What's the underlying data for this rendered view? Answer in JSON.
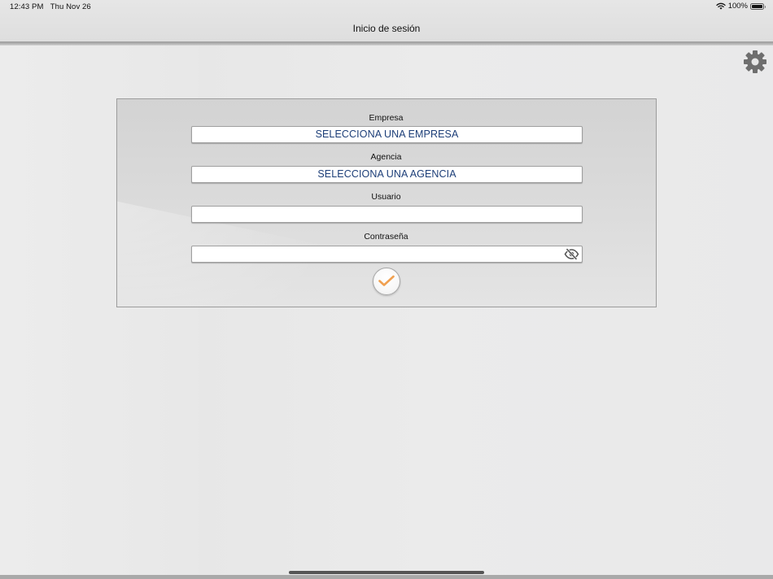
{
  "status_bar": {
    "time": "12:43 PM",
    "date": "Thu Nov 26",
    "battery_percent": "100%",
    "battery_level": 1.0,
    "icons": [
      "wifi-icon",
      "battery-icon"
    ]
  },
  "nav": {
    "title": "Inicio de sesión"
  },
  "settings": {
    "icon": "gear-icon"
  },
  "form": {
    "company": {
      "label": "Empresa",
      "value": "SELECCIONA UNA EMPRESA"
    },
    "agency": {
      "label": "Agencia",
      "value": "SELECCIONA UNA AGENCIA"
    },
    "user": {
      "label": "Usuario",
      "value": ""
    },
    "password": {
      "label": "Contraseña",
      "value": "",
      "toggle_icon": "eye-slash-icon"
    },
    "submit": {
      "icon": "checkmark-icon"
    }
  },
  "colors": {
    "select_text": "#1c3e78",
    "checkmark": "#f0a050",
    "panel_border": "#9c9c9c",
    "nav_divider": "#9a9a9a"
  }
}
